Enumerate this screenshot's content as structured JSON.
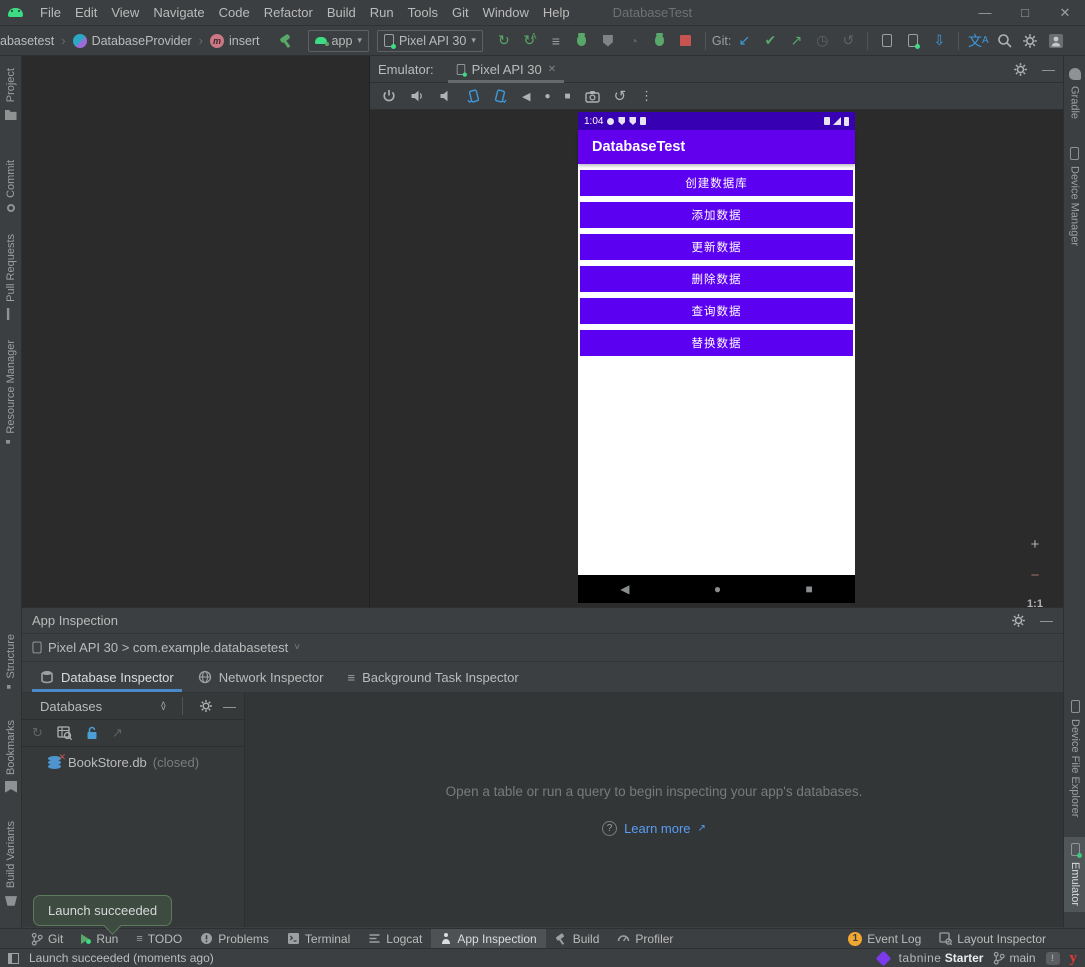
{
  "titlebar": {
    "menus": [
      "File",
      "Edit",
      "View",
      "Navigate",
      "Code",
      "Refactor",
      "Build",
      "Run",
      "Tools",
      "Git",
      "Window",
      "Help"
    ],
    "title": "DatabaseTest"
  },
  "toolbar": {
    "breadcrumb": [
      "abasetest",
      "DatabaseProvider",
      "insert"
    ],
    "run_config": "app",
    "device": "Pixel API 30",
    "git_label": "Git:"
  },
  "left_strip": {
    "top": [
      "Project",
      "Commit",
      "Pull Requests",
      "Resource Manager"
    ],
    "bottom": [
      "Structure",
      "Bookmarks",
      "Build Variants"
    ]
  },
  "right_strip": {
    "top": [
      "Gradle",
      "Device Manager"
    ],
    "bottom": [
      "Device File Explorer",
      "Emulator"
    ]
  },
  "emulator_panel": {
    "label": "Emulator:",
    "tab": "Pixel API 30",
    "zoom_ratio": "1:1"
  },
  "phone": {
    "time": "1:04",
    "app_title": "DatabaseTest",
    "buttons": [
      "创建数据库",
      "添加数据",
      "更新数据",
      "删除数据",
      "查询数据",
      "替换数据"
    ]
  },
  "inspection": {
    "title": "App Inspection",
    "process": "Pixel API 30 > com.example.databasetest",
    "tabs": [
      "Database Inspector",
      "Network Inspector",
      "Background Task Inspector"
    ],
    "databases_title": "Databases",
    "db_name": "BookStore.db",
    "db_status": "(closed)",
    "empty_text": "Open a table or run a query to begin inspecting your app's databases.",
    "learn_more": "Learn more"
  },
  "balloon": {
    "text": "Launch succeeded"
  },
  "bottom_bar": {
    "items": [
      "Git",
      "Run",
      "TODO",
      "Problems",
      "Terminal",
      "Logcat",
      "App Inspection",
      "Build",
      "Profiler"
    ],
    "event_log": "Event Log",
    "event_count": "1",
    "layout_inspector": "Layout Inspector"
  },
  "statusbar": {
    "message": "Launch succeeded (moments ago)",
    "tabnine_name": "tabnine",
    "tabnine_plan": "Starter",
    "branch": "main"
  },
  "icons": {
    "minimize": "—",
    "maximize": "□",
    "close": "✕",
    "chevron": "▾",
    "chevron_sm": "˅",
    "crumb_sep": "›",
    "tab_close": "✕",
    "rerun": "↻",
    "apply_letter": "A",
    "lines": "≡",
    "git_update": "↙",
    "git_commit": "✔",
    "git_push": "↗",
    "history": "◷",
    "rollback": "↺",
    "kebab": "⋮",
    "nav_back": "◀",
    "nav_home": "●",
    "nav_recent": "■",
    "zoom_in": "+",
    "zoom_out": "−",
    "refresh": "↻",
    "export": "↗",
    "translate_cjk": "文",
    "translate_a": "A",
    "gauge": "◔",
    "collapse_up": "˄",
    "collapse_down": "˅",
    "question": "?",
    "panel_min": "—",
    "ext_link": "↗",
    "sdk_arrow": "⇩",
    "box": "▣"
  },
  "colors": {
    "app_bar": "#6200EE",
    "status_bar_purple": "#3700B3",
    "phone_button": "#5B00F0",
    "accent_blue": "#4A88C7",
    "link": "#589DF6",
    "balloon_bg": "#3E4B40",
    "balloon_border": "#5C7B5C",
    "event_badge": "#F0A732",
    "run_green": "#59A869",
    "stop_red": "#C75450",
    "tabnine_purple": "#7C3AED",
    "ide_chrome": "#3c3f41",
    "editor_bg": "#2b2b2b"
  }
}
